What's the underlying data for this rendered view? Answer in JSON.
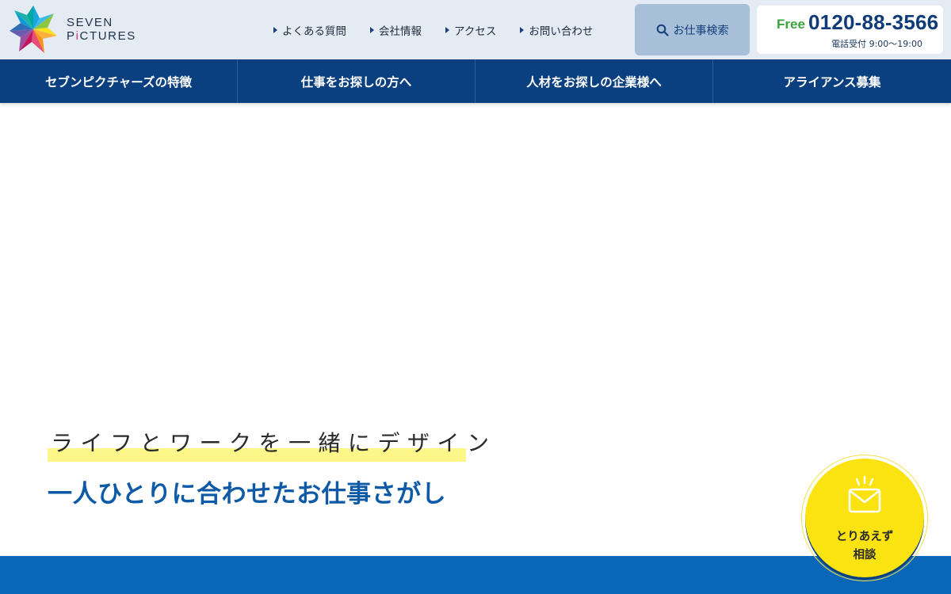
{
  "header": {
    "logo_text_before": "SEVEN P",
    "logo_text_accent": "i",
    "logo_text_after": "CTURES",
    "top_links": [
      {
        "label": "よくある質問"
      },
      {
        "label": "会社情報"
      },
      {
        "label": "アクセス"
      },
      {
        "label": "お問い合わせ"
      }
    ],
    "job_search_label": "お仕事検索",
    "phone": {
      "free_label": "Free",
      "number": "0120-88-3566",
      "hours": "電話受付 9:00〜19:00"
    }
  },
  "nav": {
    "items": [
      {
        "label": "セブンピクチャーズの特徴"
      },
      {
        "label": "仕事をお探しの方へ"
      },
      {
        "label": "人材をお探しの企業様へ"
      },
      {
        "label": "アライアンス募集"
      }
    ]
  },
  "hero": {
    "tagline": "ライフとワークを一緒にデザイン",
    "title": "一人ひとりに合わせたお仕事さがし"
  },
  "consult": {
    "line1": "とりあえず",
    "line2": "相談"
  },
  "colors": {
    "header_bg": "#e4ebf3",
    "nav_bg": "#0b4080",
    "accent_blue": "#0f5aa6",
    "free_green": "#3aa53a",
    "highlight_yellow": "#fdf78a",
    "consult_yellow": "#fbe311",
    "band_blue": "#0a66b8"
  },
  "icons": {
    "logo": "star-burst-logo",
    "search": "search-icon",
    "mail": "envelope-icon"
  }
}
